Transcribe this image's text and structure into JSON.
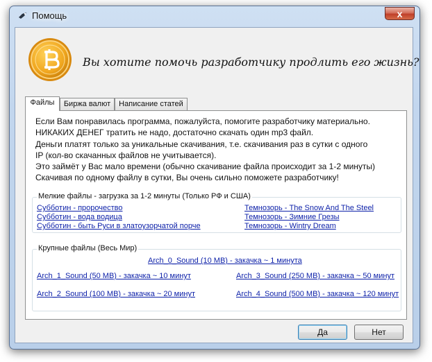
{
  "window": {
    "title": "Помощь",
    "close_glyph": "x"
  },
  "header": {
    "headline": "Вы хотите помочь разработчику продлить его жизнь?",
    "logo_icon": "bitcoin-coin-icon",
    "coin_color": "#f0a61e"
  },
  "tabs": [
    {
      "label": "Файлы",
      "active": true
    },
    {
      "label": "Биржа валют",
      "active": false
    },
    {
      "label": "Написание статей",
      "active": false
    }
  ],
  "files_tab": {
    "intro_lines": [
      "Если Вам понравилась программа, пожалуйста, помогите разработчику материально.",
      "НИКАКИХ ДЕНЕГ тратить не надо, достаточно скачать один mp3 файл.",
      "Деньги платят только за уникальные скачивания, т.е. скачивания раз в сутки с одного",
      "IP (кол-во скачанных файлов не учитывается).",
      "Это займёт у Вас мало времени (обычно скачивание файла происходит за 1-2 минуты)",
      "Скачивая по одному файлу в сутки, Вы очень сильно поможете разработчику!"
    ],
    "small_files": {
      "title": "Мелкие файлы - загрузка за 1-2 минуты (Только РФ и США)",
      "left_links": [
        "Субботин - пророчество",
        "Субботин - вода водица",
        "Субботин - быть Руси в златоузорчатой порче"
      ],
      "right_links": [
        "Темнозорь - The Snow And The Steel",
        "Темнозорь - Зимние Грезы",
        "Темнозорь - Wintry Dream"
      ]
    },
    "large_files": {
      "title": "Крупные файлы (Весь Мир)",
      "center_link": "Arch_0_Sound (10 MB) - закачка ~ 1 минута",
      "left_links": [
        "Arch_1_Sound (50 MB) - закачка ~ 10 минут",
        "Arch_2_Sound (100 MB) - закачка ~ 20 минут"
      ],
      "right_links": [
        "Arch_3_Sound (250 MB) - закачка ~ 50 минут",
        "Arch_4_Sound (500 MB) - закачка ~ 120 минут"
      ]
    }
  },
  "buttons": {
    "yes": "Да",
    "no": "Нет"
  },
  "colors": {
    "link": "#0b1fa8",
    "title_bar": "#c2d6ee",
    "close_button": "#c0402a"
  }
}
